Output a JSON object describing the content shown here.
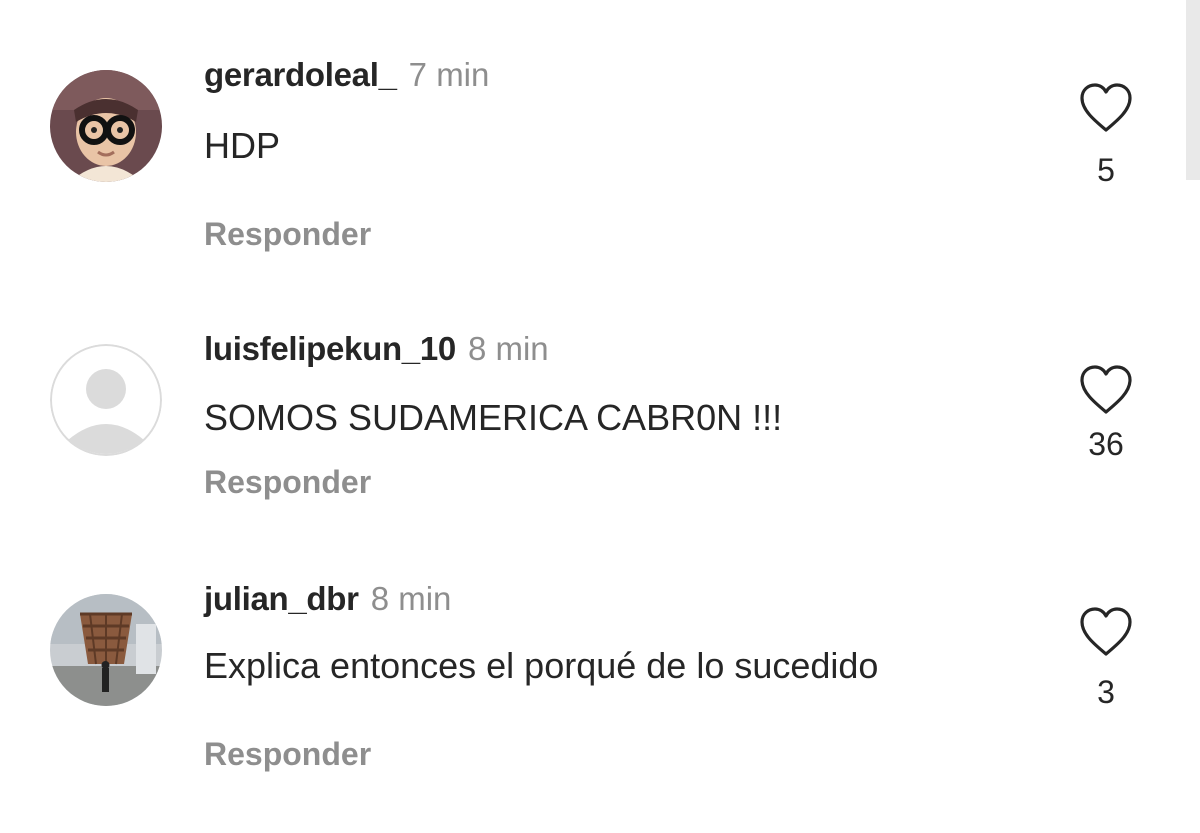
{
  "comments": [
    {
      "username": "gerardoleal_",
      "time": "7 min",
      "text": "HDP",
      "reply_label": "Responder",
      "likes": "5",
      "avatar": "child-with-glasses-photo"
    },
    {
      "username": "luisfelipekun_10",
      "time": "8 min",
      "text": "SOMOS SUDAMERICA CABR0N !!!",
      "reply_label": "Responder",
      "likes": "36",
      "avatar": "default-avatar"
    },
    {
      "username": "julian_dbr",
      "time": "8 min",
      "text": "Explica entonces el porqué de lo sucedido",
      "reply_label": "Responder",
      "likes": "3",
      "avatar": "person-at-vessel-structure-photo"
    }
  ],
  "icons": {
    "like": "heart-outline-icon"
  },
  "colors": {
    "text_primary": "#262626",
    "text_secondary": "#8e8e8e",
    "background": "#ffffff"
  }
}
